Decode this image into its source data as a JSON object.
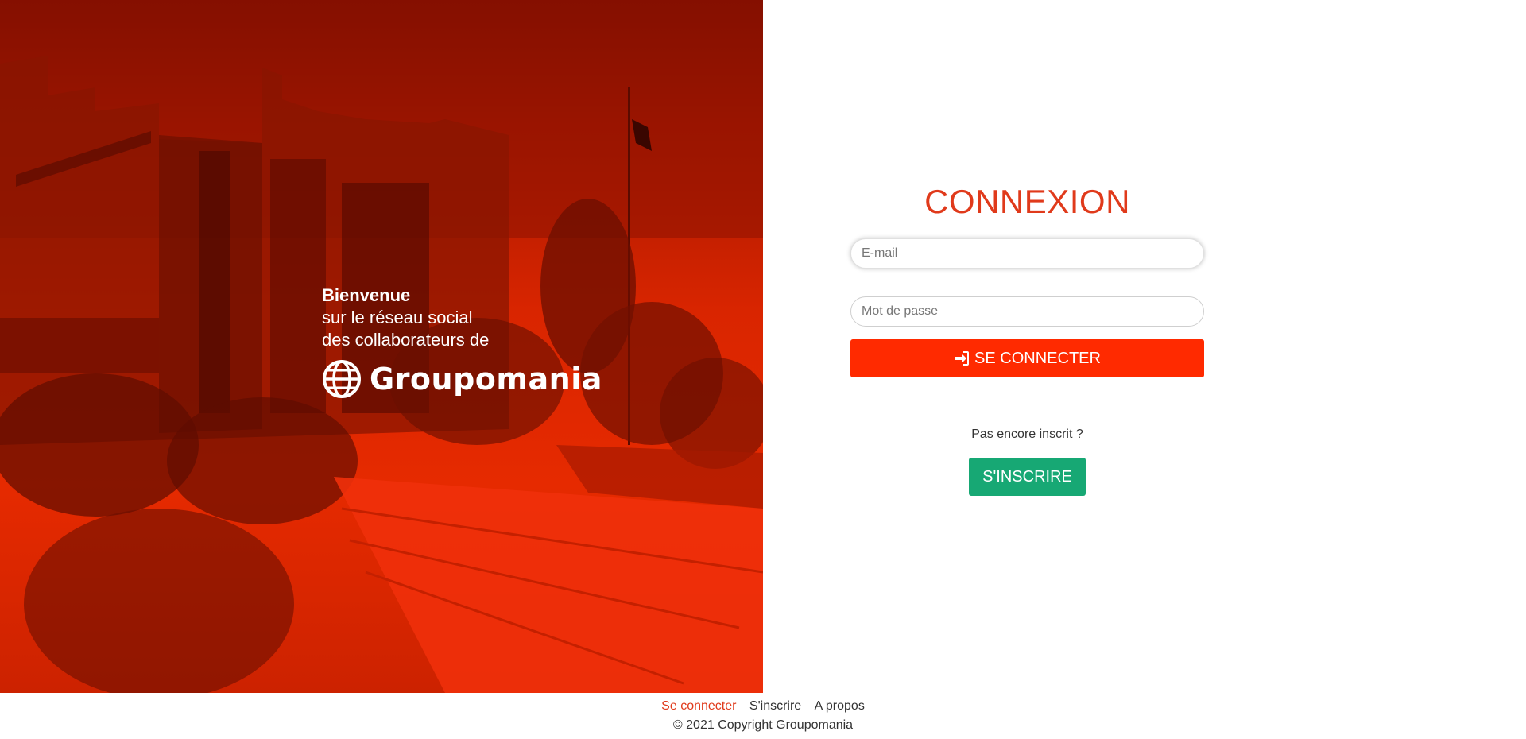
{
  "hero": {
    "welcome": "Bienvenue",
    "line1": "sur le réseau social",
    "line2": "des collaborateurs de",
    "brand": "Groupomania",
    "tint_color": "#e62a00"
  },
  "login": {
    "title": "CONNEXION",
    "email_placeholder": "E-mail",
    "password_placeholder": "Mot de passe",
    "submit_label": "SE CONNECTER",
    "submit_icon": "sign-in-icon",
    "not_registered": "Pas encore inscrit ?",
    "signup_label": "S'INSCRIRE"
  },
  "footer": {
    "links": [
      {
        "label": "Se connecter",
        "active": true
      },
      {
        "label": "S'inscrire",
        "active": false
      },
      {
        "label": "A propos",
        "active": false
      }
    ],
    "copyright": "© 2021 Copyright Groupomania"
  },
  "colors": {
    "accent": "#e03a1b",
    "login_button": "#ff2a00",
    "signup_button": "#17a874"
  }
}
